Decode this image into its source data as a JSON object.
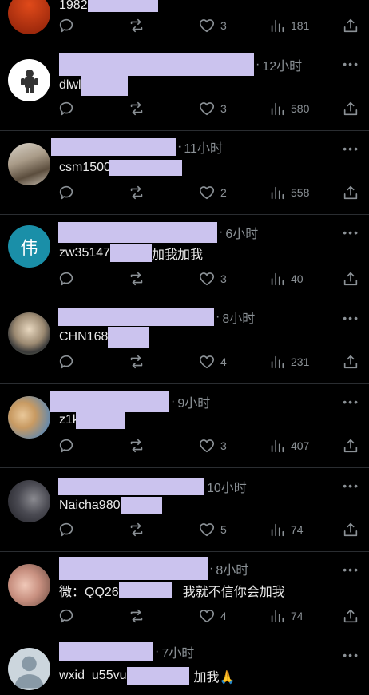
{
  "actions": {
    "reply": "reply",
    "retweet": "retweet",
    "like": "like",
    "views": "views",
    "share": "share"
  },
  "posts": [
    {
      "avatar_type": "orange",
      "time": "",
      "content_prefix": "1982",
      "content_suffix": "",
      "likes": "3",
      "views": "181"
    },
    {
      "avatar_type": "figure",
      "time": "12小时",
      "content_prefix": "dlwl",
      "content_suffix": "",
      "likes": "3",
      "views": "580"
    },
    {
      "avatar_type": "photo-house",
      "time": "11小时",
      "content_prefix": "csm15007",
      "content_suffix": "",
      "likes": "2",
      "views": "558"
    },
    {
      "avatar_type": "letter",
      "avatar_letter": "伟",
      "time": "6小时",
      "content_prefix": "zw35147",
      "content_suffix": "加我加我",
      "likes": "3",
      "views": "40"
    },
    {
      "avatar_type": "photo-anime",
      "time": "8小时",
      "content_prefix": "CHN168",
      "content_suffix": "",
      "likes": "4",
      "views": "231"
    },
    {
      "avatar_type": "photo-cats",
      "time": "9小时",
      "content_prefix": "z1k",
      "content_suffix": "",
      "likes": "3",
      "views": "407"
    },
    {
      "avatar_type": "photo-girl",
      "time": "10小时",
      "content_prefix": "Naicha980",
      "content_suffix": "",
      "likes": "5",
      "views": "74"
    },
    {
      "avatar_type": "photo-pink",
      "time": "8小时",
      "content_prefix": "微：QQ26",
      "content_suffix": "我就不信你会加我",
      "likes": "4",
      "views": "74"
    },
    {
      "avatar_type": "default",
      "time": "7小时",
      "content_prefix": "wxid_u55vu",
      "content_suffix": "加我🙏",
      "likes": "",
      "views": ""
    }
  ],
  "colors": {
    "background": "#000000",
    "text": "#e7e9ea",
    "muted": "#8b9196",
    "redaction": "#cbc3ee",
    "divider": "#2a2d31"
  }
}
